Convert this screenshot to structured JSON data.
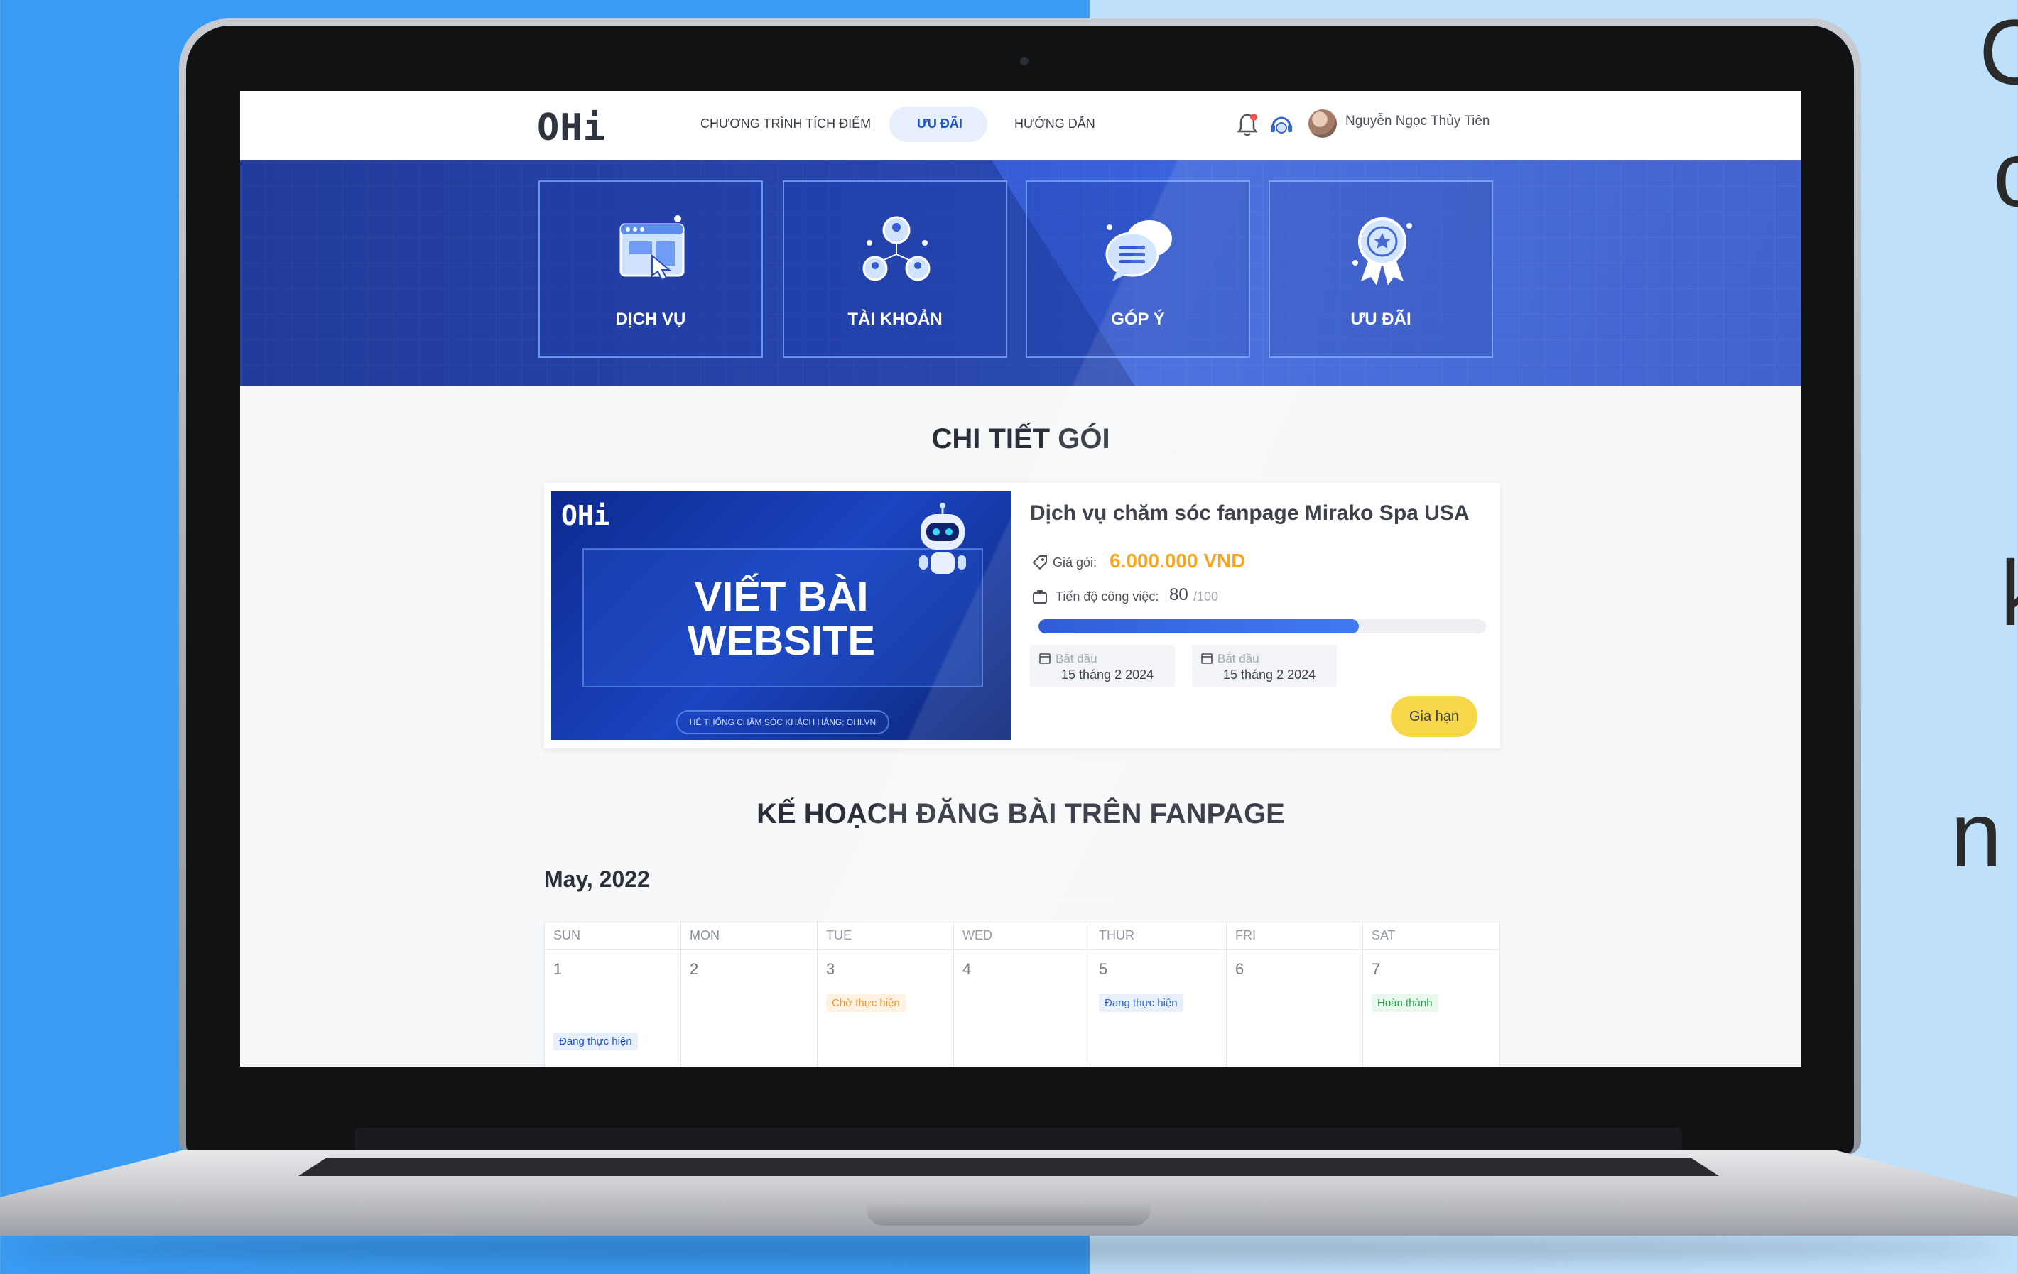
{
  "backdrop": {
    "side_text": [
      "C",
      "c",
      "k",
      "n"
    ]
  },
  "navbar": {
    "logo": "OHi",
    "links": [
      "CHƯƠNG TRÌNH TÍCH ĐIỂM",
      "ƯU ĐÃI",
      "HƯỚNG DẪN"
    ],
    "active_link_index": 1,
    "user_name": "Nguyễn Ngọc Thủy Tiên"
  },
  "banner": {
    "tiles": [
      {
        "label": "DỊCH VỤ",
        "icon": "browser-click-icon"
      },
      {
        "label": "TÀI KHOẢN",
        "icon": "users-network-icon"
      },
      {
        "label": "GÓP Ý",
        "icon": "chat-bubbles-icon"
      },
      {
        "label": "ƯU ĐÃI",
        "icon": "award-ribbon-icon"
      }
    ]
  },
  "package": {
    "section_title": "CHI TIẾT GÓI",
    "thumb": {
      "logo": "OHi",
      "title_line1": "VIẾT BÀI",
      "title_line2": "WEBSITE",
      "footer": "HỆ THỐNG CHĂM SÓC KHÁCH HÀNG: OHI.VN"
    },
    "title": "Dịch vụ chăm sóc fanpage Mirako Spa USA",
    "price_label": "Giá gói:",
    "price_value": "6.000.000 VND",
    "progress_label": "Tiến độ công việc:",
    "progress_value": "80",
    "progress_max": "/100",
    "progress_fraction": 0.8,
    "dates": [
      {
        "label": "Bắt đầu",
        "value": "15 tháng 2 2024"
      },
      {
        "label": "Bắt đầu",
        "value": "15 tháng 2 2024"
      }
    ],
    "renew_label": "Gia hạn"
  },
  "calendar": {
    "section_title": "KẾ HOẠCH ĐĂNG BÀI TRÊN FANPAGE",
    "month": "May, 2022",
    "weekdays": [
      "SUN",
      "MON",
      "TUE",
      "WED",
      "THUR",
      "FRI",
      "SAT"
    ],
    "days": [
      {
        "date": "1",
        "status": "Đang thực hiện",
        "kind": "progress",
        "slot": 2
      },
      {
        "date": "2",
        "status": "",
        "kind": "",
        "slot": 0
      },
      {
        "date": "3",
        "status": "Chờ thực hiện",
        "kind": "wait",
        "slot": 1
      },
      {
        "date": "4",
        "status": "",
        "kind": "",
        "slot": 0
      },
      {
        "date": "5",
        "status": "Đang thực hiện",
        "kind": "progress",
        "slot": 1
      },
      {
        "date": "6",
        "status": "",
        "kind": "",
        "slot": 0
      },
      {
        "date": "7",
        "status": "Hoàn thành",
        "kind": "done",
        "slot": 1
      }
    ]
  },
  "colors": {
    "accent": "#1e56c8",
    "price": "#f59d0b",
    "renew_button": "#f8d33a",
    "banner": "#3458d0"
  }
}
